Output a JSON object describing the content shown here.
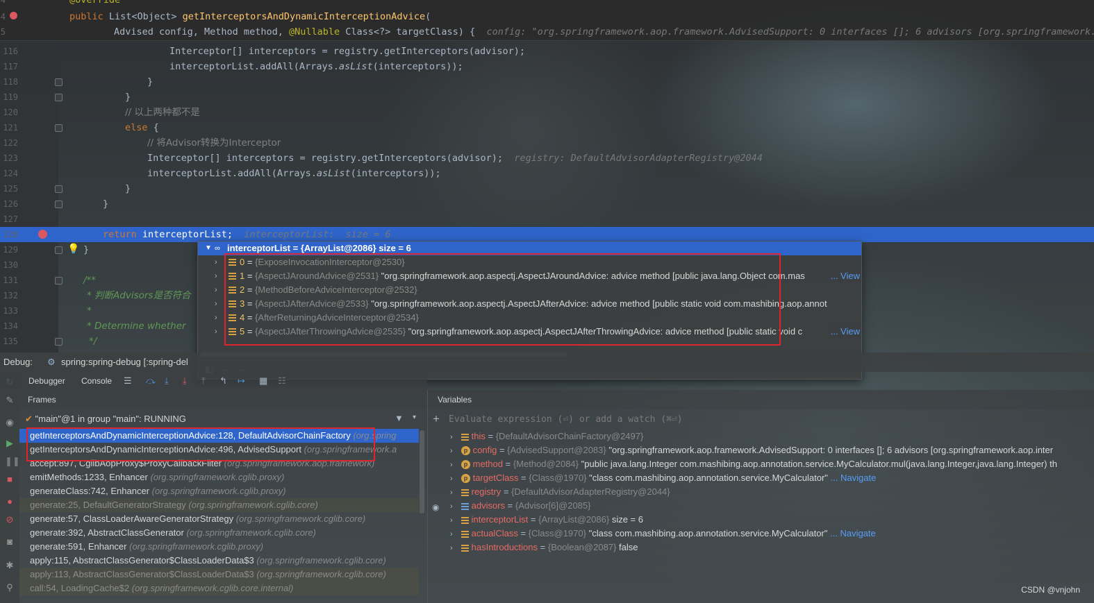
{
  "editor": {
    "lines": [
      {
        "num": "4",
        "text": "@Override"
      },
      {
        "num": "4",
        "kw": "public ",
        "type": "List<Object> ",
        "fn": "getInterceptorsAndDynamicInterceptionAdvice",
        "rest": "("
      },
      {
        "num": "5",
        "text_a": "Advised config, Method method, ",
        "ann": "@Nullable",
        "text_b": " Class<?> targetClass) {",
        "hint": "config: \"org.springframework.aop.framework.AdvisedSupport: 0 interfaces []; 6 advisors [org.springframework.aop.in"
      },
      {
        "num": "116",
        "text": "Interceptor[] interceptors = registry.getInterceptors(advisor);"
      },
      {
        "num": "117",
        "text_a": "interceptorList.addAll(Arrays.",
        "ital": "asList",
        "text_b": "(interceptors));"
      },
      {
        "num": "118",
        "text": "}"
      },
      {
        "num": "119",
        "text": "}"
      },
      {
        "num": "120",
        "comment": "// 以上两种都不是"
      },
      {
        "num": "121",
        "kw": "else",
        "rest": " {"
      },
      {
        "num": "122",
        "comment": "// 将Advisor转换为Interceptor"
      },
      {
        "num": "123",
        "text": "Interceptor[] interceptors = registry.getInterceptors(advisor);",
        "hint": "registry: DefaultAdvisorAdapterRegistry@2044"
      },
      {
        "num": "124",
        "text_a": "interceptorList.addAll(Arrays.",
        "ital": "asList",
        "text_b": "(interceptors));"
      },
      {
        "num": "125",
        "text": "}"
      },
      {
        "num": "126",
        "text": "}"
      },
      {
        "num": "127",
        "text": ""
      },
      {
        "num": "128",
        "kw": "return ",
        "rest": "interceptorList;",
        "hint_a": "interceptorList:",
        "hint_b": "size = 6"
      },
      {
        "num": "129",
        "text": "}"
      },
      {
        "num": "130",
        "text": ""
      },
      {
        "num": "131",
        "doc": "/**"
      },
      {
        "num": "132",
        "doc": "* 判断Advisors是否符合"
      },
      {
        "num": "133",
        "doc": "*"
      },
      {
        "num": "134",
        "doc": "* Determine whether"
      },
      {
        "num": "135",
        "doc": "*/"
      }
    ]
  },
  "popup": {
    "title": "interceptorList = {ArrayList@2086}  size = 6",
    "items": [
      {
        "idx": "0",
        "ref": "{ExposeInvocationInterceptor@2530}",
        "val": "",
        "view": ""
      },
      {
        "idx": "1",
        "ref": "{AspectJAroundAdvice@2531}",
        "val": "\"org.springframework.aop.aspectj.AspectJAroundAdvice: advice method [public java.lang.Object com.mas",
        "view": "... View"
      },
      {
        "idx": "2",
        "ref": "{MethodBeforeAdviceInterceptor@2532}",
        "val": "",
        "view": ""
      },
      {
        "idx": "3",
        "ref": "{AspectJAfterAdvice@2533}",
        "val": "\"org.springframework.aop.aspectj.AspectJAfterAdvice: advice method [public static void com.mashibing.aop.annot",
        "view": ""
      },
      {
        "idx": "4",
        "ref": "{AfterReturningAdviceInterceptor@2534}",
        "val": "",
        "view": ""
      },
      {
        "idx": "5",
        "ref": "{AspectJAfterThrowingAdvice@2535}",
        "val": "\"org.springframework.aop.aspectj.AspectJAfterThrowingAdvice: advice method [public static void c",
        "view": "... View"
      }
    ]
  },
  "debug": {
    "label": "Debug:",
    "session": "spring:spring-debug [:spring-del",
    "tabs": [
      "Debugger",
      "Console"
    ]
  },
  "frames": {
    "header": "Frames",
    "thread": "\"main\"@1 in group \"main\": RUNNING",
    "rows": [
      {
        "method": "getInterceptorsAndDynamicInterceptionAdvice:128, DefaultAdvisorChainFactory",
        "pkg": "(org.spring",
        "dim": false
      },
      {
        "method": "getInterceptorsAndDynamicInterceptionAdvice:496, AdvisedSupport",
        "pkg": "(org.springframework.a",
        "dim": false
      },
      {
        "method": "accept:897, CglibAopProxy$ProxyCallbackFilter",
        "pkg": "(org.springframework.aop.framework)",
        "dim": false
      },
      {
        "method": "emitMethods:1233, Enhancer",
        "pkg": "(org.springframework.cglib.proxy)",
        "dim": false
      },
      {
        "method": "generateClass:742, Enhancer",
        "pkg": "(org.springframework.cglib.proxy)",
        "dim": false
      },
      {
        "method": "generate:25, DefaultGeneratorStrategy",
        "pkg": "(org.springframework.cglib.core)",
        "dim": true
      },
      {
        "method": "generate:57, ClassLoaderAwareGeneratorStrategy",
        "pkg": "(org.springframework.cglib.core)",
        "dim": false
      },
      {
        "method": "generate:392, AbstractClassGenerator",
        "pkg": "(org.springframework.cglib.core)",
        "dim": false
      },
      {
        "method": "generate:591, Enhancer",
        "pkg": "(org.springframework.cglib.proxy)",
        "dim": false
      },
      {
        "method": "apply:115, AbstractClassGenerator$ClassLoaderData$3",
        "pkg": "(org.springframework.cglib.core)",
        "dim": false
      },
      {
        "method": "apply:113, AbstractClassGenerator$ClassLoaderData$3",
        "pkg": "(org.springframework.cglib.core)",
        "dim": true
      },
      {
        "method": "call:54, LoadingCache$2",
        "pkg": "(org.springframework.cglib.core.internal)",
        "dim": true
      }
    ]
  },
  "variables": {
    "header": "Variables",
    "eval_placeholder": "Evaluate expression (⏎) or add a watch (⌘⏎)",
    "rows": [
      {
        "icon": "lines",
        "name": "this",
        "ref": "{DefaultAdvisorChainFactory@2497}",
        "val": "",
        "nav": ""
      },
      {
        "icon": "p",
        "name": "config",
        "ref": "{AdvisedSupport@2083}",
        "val": "\"org.springframework.aop.framework.AdvisedSupport: 0 interfaces []; 6 advisors [org.springframework.aop.inter",
        "nav": ""
      },
      {
        "icon": "p",
        "name": "method",
        "ref": "{Method@2084}",
        "val": "\"public java.lang.Integer com.mashibing.aop.annotation.service.MyCalculator.mul(java.lang.Integer,java.lang.Integer) th",
        "nav": ""
      },
      {
        "icon": "p",
        "name": "targetClass",
        "ref": "{Class@1970}",
        "val": "\"class com.mashibing.aop.annotation.service.MyCalculator\"",
        "nav": "... Navigate"
      },
      {
        "icon": "lines",
        "name": "registry",
        "ref": "{DefaultAdvisorAdapterRegistry@2044}",
        "val": "",
        "nav": ""
      },
      {
        "icon": "arr",
        "name": "advisors",
        "ref": "{Advisor[6]@2085}",
        "val": "",
        "nav": ""
      },
      {
        "icon": "lines",
        "name": "interceptorList",
        "ref": "{ArrayList@2086}",
        "val": " size = 6",
        "nav": ""
      },
      {
        "icon": "lines",
        "name": "actualClass",
        "ref": "{Class@1970}",
        "val": "\"class com.mashibing.aop.annotation.service.MyCalculator\"",
        "nav": "... Navigate"
      },
      {
        "icon": "lines",
        "name": "hasIntroductions",
        "ref": "{Boolean@2087}",
        "val": "false",
        "nav": ""
      }
    ]
  },
  "watermark": "CSDN @vnjohn",
  "colors": {
    "selection": "#2f65ca",
    "breakpoint": "#db5860",
    "highlight_box": "#e0242c"
  }
}
